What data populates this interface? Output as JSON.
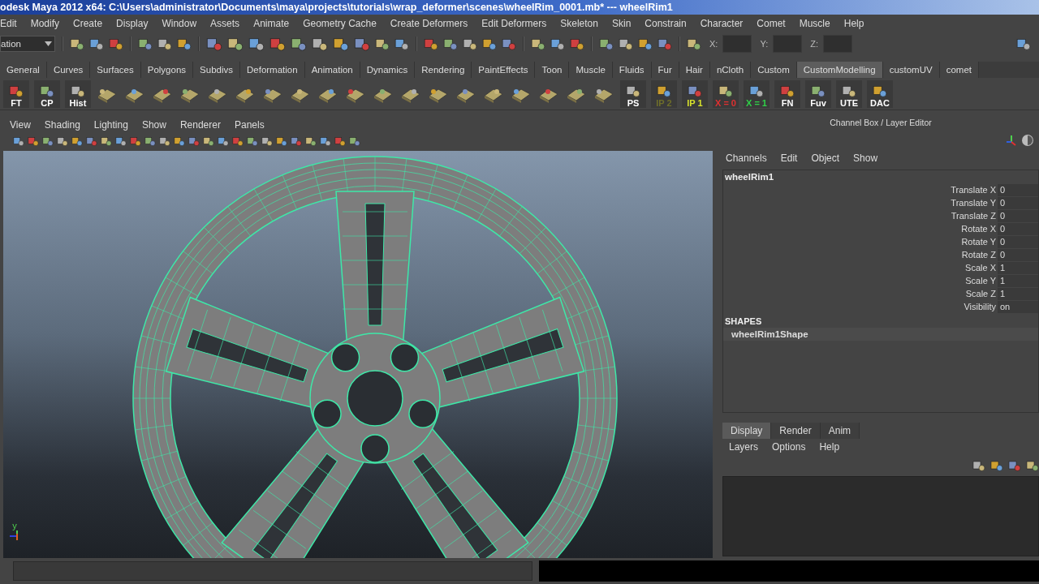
{
  "window": {
    "title": "odesk Maya 2012 x64: C:\\Users\\administrator\\Documents\\maya\\projects\\tutorials\\wrap_deformer\\scenes\\wheelRim_0001.mb*  ---  wheelRim1"
  },
  "menu_bar": [
    "Edit",
    "Modify",
    "Create",
    "Display",
    "Window",
    "Assets",
    "Animate",
    "Geometry Cache",
    "Create Deformers",
    "Edit Deformers",
    "Skeleton",
    "Skin",
    "Constrain",
    "Character",
    "Comet",
    "Muscle",
    "Help"
  ],
  "status_line": {
    "mode_dropdown": "ation",
    "coord_labels": [
      "X:",
      "Y:",
      "Z:"
    ]
  },
  "shelf_tabs": [
    {
      "label": "General",
      "selected": false
    },
    {
      "label": "Curves",
      "selected": false
    },
    {
      "label": "Surfaces",
      "selected": false
    },
    {
      "label": "Polygons",
      "selected": false
    },
    {
      "label": "Subdivs",
      "selected": false
    },
    {
      "label": "Deformation",
      "selected": false
    },
    {
      "label": "Animation",
      "selected": false
    },
    {
      "label": "Dynamics",
      "selected": false
    },
    {
      "label": "Rendering",
      "selected": false
    },
    {
      "label": "PaintEffects",
      "selected": false
    },
    {
      "label": "Toon",
      "selected": false
    },
    {
      "label": "Muscle",
      "selected": false
    },
    {
      "label": "Fluids",
      "selected": false
    },
    {
      "label": "Fur",
      "selected": false
    },
    {
      "label": "Hair",
      "selected": false
    },
    {
      "label": "nCloth",
      "selected": false
    },
    {
      "label": "Custom",
      "selected": false
    },
    {
      "label": "CustomModelling",
      "selected": true
    },
    {
      "label": "customUV",
      "selected": false
    },
    {
      "label": "comet",
      "selected": false
    }
  ],
  "shelf": {
    "leading_buttons": [
      {
        "label": "FT",
        "color": "#ffffff"
      },
      {
        "label": "CP",
        "color": "#ffffff"
      },
      {
        "label": "Hist",
        "color": "#ffffff"
      }
    ],
    "trailing_buttons": [
      {
        "label": "PS",
        "color": "#ffffff"
      },
      {
        "label": "IP 2",
        "color": "#6e6e2a"
      },
      {
        "label": "IP 1",
        "color": "#d6e02c"
      },
      {
        "label": "X = 0",
        "color": "#e03030"
      },
      {
        "label": "X = 1",
        "color": "#30d048"
      },
      {
        "label": "FN",
        "color": "#ffffff"
      },
      {
        "label": "Fuv",
        "color": "#ffffff"
      },
      {
        "label": "UTE",
        "color": "#ffffff"
      },
      {
        "label": "DAC",
        "color": "#ffffff"
      }
    ]
  },
  "viewport": {
    "menu": [
      "View",
      "Shading",
      "Lighting",
      "Show",
      "Renderer",
      "Panels"
    ],
    "axis_label": "y"
  },
  "channel_box": {
    "title": "Channel Box / Layer Editor",
    "menu": [
      "Channels",
      "Edit",
      "Object",
      "Show"
    ],
    "object": "wheelRim1",
    "channels": [
      {
        "name": "Translate X",
        "value": "0"
      },
      {
        "name": "Translate Y",
        "value": "0"
      },
      {
        "name": "Translate Z",
        "value": "0"
      },
      {
        "name": "Rotate X",
        "value": "0"
      },
      {
        "name": "Rotate Y",
        "value": "0"
      },
      {
        "name": "Rotate Z",
        "value": "0"
      },
      {
        "name": "Scale X",
        "value": "1"
      },
      {
        "name": "Scale Y",
        "value": "1"
      },
      {
        "name": "Scale Z",
        "value": "1"
      },
      {
        "name": "Visibility",
        "value": "on"
      }
    ],
    "shapes_heading": "SHAPES",
    "shape": "wheelRim1Shape"
  },
  "layer_editor": {
    "tabs": [
      {
        "label": "Display",
        "selected": true
      },
      {
        "label": "Render",
        "selected": false
      },
      {
        "label": "Anim",
        "selected": false
      }
    ],
    "menu": [
      "Layers",
      "Options",
      "Help"
    ]
  }
}
